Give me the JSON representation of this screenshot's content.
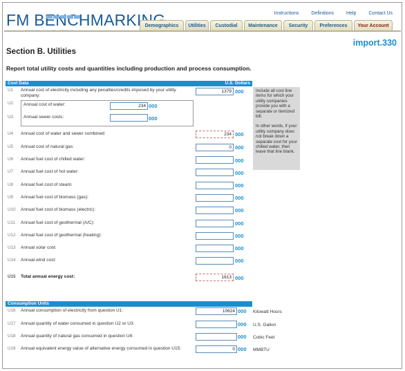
{
  "header": {
    "logo": "FM BENCHMARKING",
    "logo_tagline": "COMPARE · ANALYZE · IMPROVE",
    "top_links": [
      "Instructions",
      "Definitions",
      "Help",
      "Contact Us"
    ],
    "tabs": [
      "Demographics",
      "Utilities",
      "Custodial",
      "Maintenance",
      "Security",
      "Preferences",
      "Your Account"
    ],
    "active_tab": "Utilities"
  },
  "import_id": "import.330",
  "section": {
    "title": "Section B. Utilities",
    "description": "Report total utility costs and quantities including production and process consumption."
  },
  "cost_data": {
    "band_label": "Cost Data",
    "currency_label": "U.S. Dollars",
    "rows": [
      {
        "id": "U1",
        "label": "Annual cost of electricity including any penalties/credits imposed by your utility company:",
        "value": "1379",
        "suffix": "000"
      },
      {
        "id": "U2",
        "label": "Annual cost of water:",
        "value": "234",
        "suffix": "000"
      },
      {
        "id": "U3",
        "label": "Annual sewer costs:",
        "value": "",
        "suffix": "000"
      },
      {
        "id": "U4",
        "label": "Annual cost of water and sewer combined:",
        "value": "234",
        "suffix": "000"
      },
      {
        "id": "U5",
        "label": "Annual cost of natural gas:",
        "value": "0",
        "suffix": "000"
      },
      {
        "id": "U6",
        "label": "Annual fuel cost of chilled water:",
        "value": "",
        "suffix": "000"
      },
      {
        "id": "U7",
        "label": "Annual fuel cost of hot water:",
        "value": "",
        "suffix": "000"
      },
      {
        "id": "U8",
        "label": "Annual fuel cost of steam:",
        "value": "",
        "suffix": "000"
      },
      {
        "id": "U9",
        "label": "Annual fuel cost of biomass (gas):",
        "value": "",
        "suffix": "000"
      },
      {
        "id": "U10",
        "label": "Annual fuel cost of biomass (electric):",
        "value": "",
        "suffix": "000"
      },
      {
        "id": "U11",
        "label": "Annual fuel cost of geothermal (A/C):",
        "value": "",
        "suffix": "000"
      },
      {
        "id": "U12",
        "label": "Annual fuel cost of geothermal (heating):",
        "value": "",
        "suffix": "000"
      },
      {
        "id": "U13",
        "label": "Annual solar cost:",
        "value": "",
        "suffix": "000"
      },
      {
        "id": "U14",
        "label": "Annual wind cost:",
        "value": "",
        "suffix": "000"
      },
      {
        "id": "U15",
        "label": "Total annual energy cost:",
        "value": "1613",
        "suffix": "000"
      }
    ],
    "side_note": [
      "Include all cost line items for which your utility companies provide you with a separate or itemized bill.",
      "In other words, if your utility company does not break down a separate cost for your chilled water, then leave that line blank."
    ]
  },
  "consumption": {
    "band_label": "Consumption Units",
    "rows": [
      {
        "id": "U16",
        "label": "Annual consumption of electricity from question U1:",
        "value": "10624",
        "suffix": "000",
        "unit": "Kilowatt Hours"
      },
      {
        "id": "U17",
        "label": "Annual quantity of water consumed in question U2 or U3:",
        "value": "",
        "suffix": "000",
        "unit": "U.S. Gallon"
      },
      {
        "id": "U18",
        "label": "Annual quantity of natural gas consumed in question U4:",
        "value": "",
        "suffix": "000",
        "unit": "Cubic Feet"
      },
      {
        "id": "U19",
        "label": "Annual equivalent energy value of alternative energy consumed in question U15:",
        "value": "0",
        "suffix": "000",
        "unit": "MMBTU"
      }
    ]
  },
  "colors": {
    "brand": "#1a5a96",
    "accent": "#1a8fd0",
    "tab_bg": "#e4dfbf"
  }
}
